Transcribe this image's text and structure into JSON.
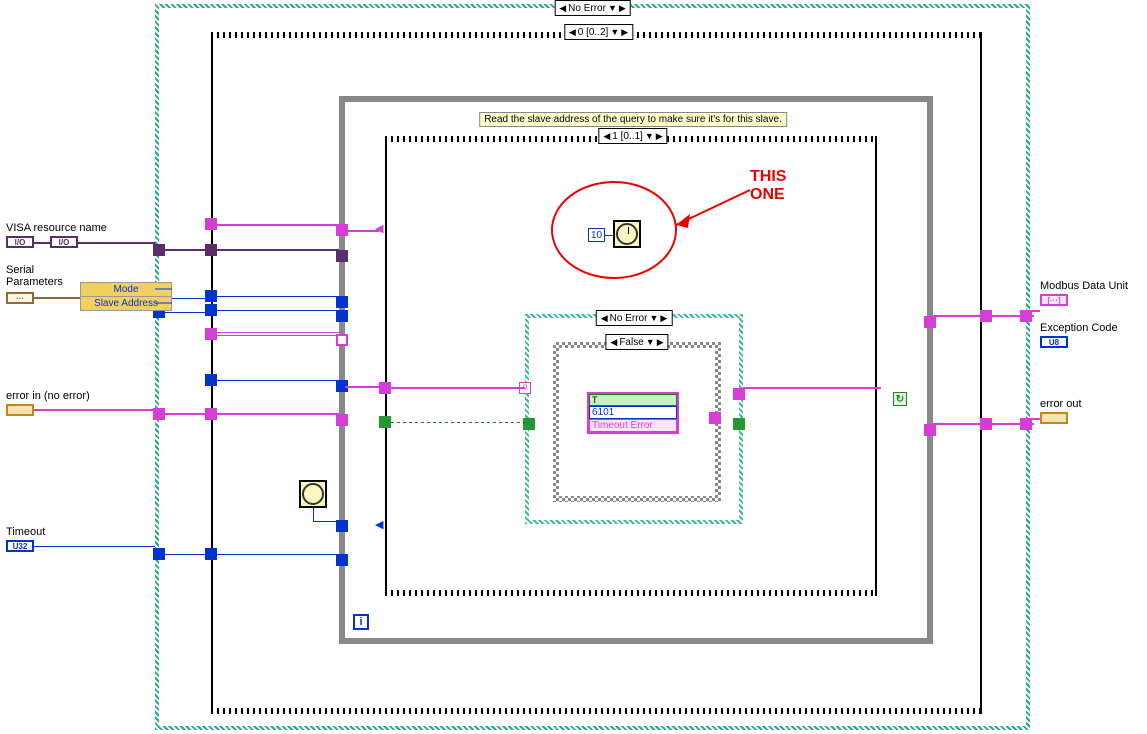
{
  "outerCase": {
    "selector": "No Error"
  },
  "seq1": {
    "selector": "0 [0..2]"
  },
  "whileLoop": {
    "iterationTerminal": "i"
  },
  "seq2": {
    "selector": "1 [0..1]",
    "comment": "Read the slave address of the query to make sure it's for this slave."
  },
  "innerCase1": {
    "selector": "No Error"
  },
  "innerCase2": {
    "selector": "False"
  },
  "waitNode": {
    "ms": "10"
  },
  "errorBundle": {
    "bool": "T",
    "code": "6101",
    "source": "Timeout Error"
  },
  "unbundle": {
    "field1": "Mode",
    "field2": "Slave Address"
  },
  "terminals": {
    "visaResource": "VISA resource name",
    "serialParams": "Serial\nParameters",
    "errorIn": "error in (no error)",
    "timeout": "Timeout",
    "modbusDataUnit": "Modbus Data Unit",
    "exceptionCode": "Exception Code",
    "errorOut": "error out"
  },
  "typeLabels": {
    "io": "I/O",
    "cluster": "···",
    "u32": "U32",
    "u8": "U8",
    "arr": "[···]"
  },
  "callout": "THIS\nONE"
}
